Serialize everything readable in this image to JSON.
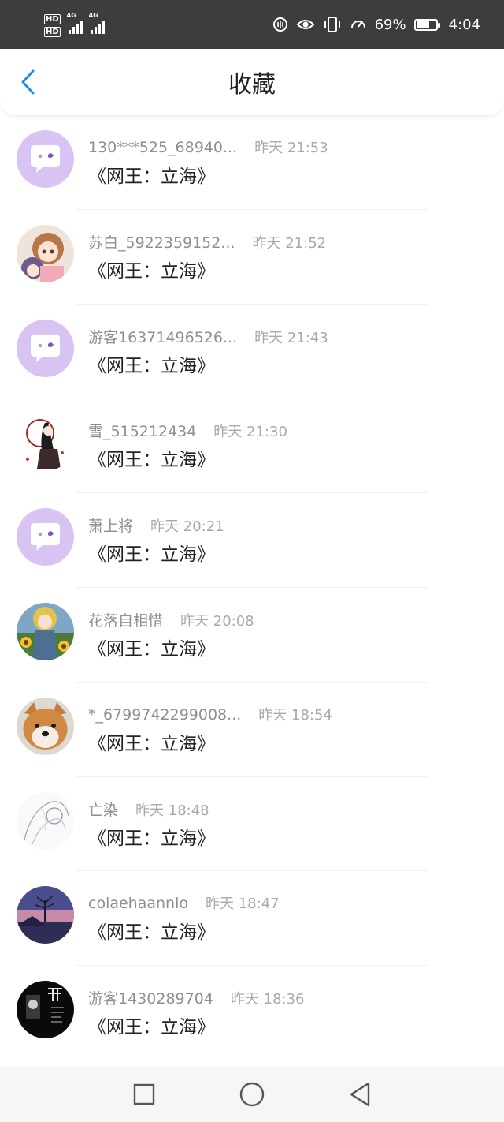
{
  "status_bar": {
    "network_1": "HD",
    "network_2": "HD",
    "signal_1": "4G",
    "signal_2": "4G",
    "battery_percent": "69%",
    "battery_level": 0.69,
    "time": "4:04"
  },
  "header": {
    "title": "收藏",
    "back_icon": "chevron-left-icon",
    "accent_color": "#1e90e6"
  },
  "list": [
    {
      "user": "130***525_68940...",
      "time": "昨天 21:53",
      "title": "《网王：立海》",
      "avatar": "default-chat"
    },
    {
      "user": "苏白_5922359152...",
      "time": "昨天 21:52",
      "title": "《网王：立海》",
      "avatar": "anime-girls"
    },
    {
      "user": "游客16371496526...",
      "time": "昨天 21:43",
      "title": "《网王：立海》",
      "avatar": "default-chat"
    },
    {
      "user": "雪_515212434",
      "time": "昨天 21:30",
      "title": "《网王：立海》",
      "avatar": "ancient-figure"
    },
    {
      "user": "萧上将",
      "time": "昨天 20:21",
      "title": "《网王：立海》",
      "avatar": "default-chat"
    },
    {
      "user": "花落自相惜",
      "time": "昨天 20:08",
      "title": "《网王：立海》",
      "avatar": "flower-girl"
    },
    {
      "user": "*_6799742299008...",
      "time": "昨天 18:54",
      "title": "《网王：立海》",
      "avatar": "shiba-dog"
    },
    {
      "user": "亡染",
      "time": "昨天 18:48",
      "title": "《网王：立海》",
      "avatar": "sketch-figure"
    },
    {
      "user": "colaehaannlo",
      "time": "昨天 18:47",
      "title": "《网王：立海》",
      "avatar": "sunset-tree"
    },
    {
      "user": "游客1430289704",
      "time": "昨天 18:36",
      "title": "《网王：立海》",
      "avatar": "dark-poster"
    }
  ],
  "nav_bar": {
    "recent_icon": "square-icon",
    "home_icon": "circle-icon",
    "back_icon": "triangle-back-icon"
  }
}
